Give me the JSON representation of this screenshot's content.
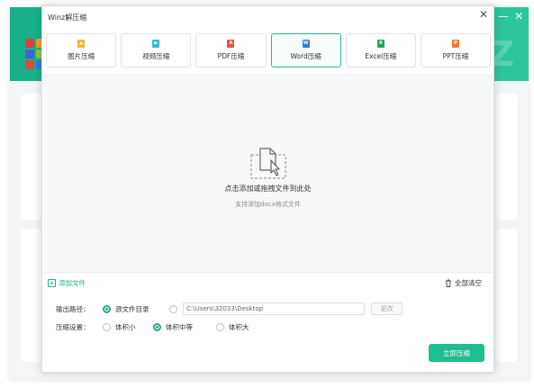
{
  "background_app": {
    "controls": {
      "minimize": "—",
      "close": "✕"
    },
    "watermark_letter": "Z",
    "header_color": "#1db88c"
  },
  "dialog": {
    "title": "Winz解压缩",
    "close_glyph": "✕",
    "tabs": [
      {
        "label": "图片压缩",
        "icon": "image-file-icon",
        "color": "#f5b52a",
        "glyph": "▲",
        "active": false
      },
      {
        "label": "视频压缩",
        "icon": "video-file-icon",
        "color": "#35b6d8",
        "glyph": "▶",
        "active": false
      },
      {
        "label": "PDF压缩",
        "icon": "pdf-file-icon",
        "color": "#e8503f",
        "glyph": "A",
        "active": false
      },
      {
        "label": "Word压缩",
        "icon": "word-file-icon",
        "color": "#2f7de1",
        "glyph": "W",
        "active": true
      },
      {
        "label": "Excel压缩",
        "icon": "excel-file-icon",
        "color": "#1fa463",
        "glyph": "X",
        "active": false
      },
      {
        "label": "PPT压缩",
        "icon": "ppt-file-icon",
        "color": "#f07a2f",
        "glyph": "P",
        "active": false
      }
    ],
    "drop": {
      "title": "点击添加或拖拽文件到此处",
      "subtitle": "支持添加docx格式文件"
    },
    "add_file_label": "添加文件",
    "clear_all_label": "全部清空",
    "output": {
      "label": "输出路径：",
      "source_dir_label": "源文件目录",
      "path_value": "C:\\Users\\32033\\Desktop",
      "change_label": "更改",
      "selected": "source"
    },
    "compression": {
      "label": "压缩设置：",
      "options": [
        "体积小",
        "体积中等",
        "体积大"
      ],
      "selected_index": 1
    },
    "start_button": "立即压缩",
    "accent_color": "#1fbe8f"
  }
}
